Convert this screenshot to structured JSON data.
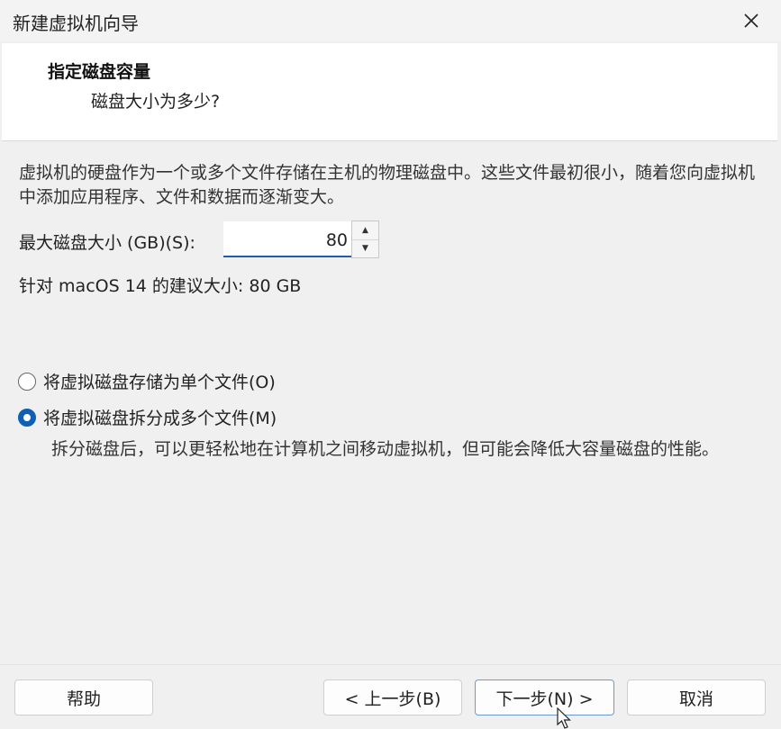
{
  "window": {
    "title": "新建虚拟机向导",
    "close_icon": "close-icon"
  },
  "header": {
    "title": "指定磁盘容量",
    "subtitle": "磁盘大小为多少?"
  },
  "description": "虚拟机的硬盘作为一个或多个文件存储在主机的物理磁盘中。这些文件最初很小，随着您向虚拟机中添加应用程序、文件和数据而逐渐变大。",
  "disk_size": {
    "label": "最大磁盘大小 (GB)(S):",
    "value": "80"
  },
  "recommendation": "针对 macOS 14 的建议大小: 80 GB",
  "options": [
    {
      "label": "将虚拟磁盘存储为单个文件(O)",
      "checked": false
    },
    {
      "label": "将虚拟磁盘拆分成多个文件(M)",
      "checked": true
    }
  ],
  "split_description": "拆分磁盘后，可以更轻松地在计算机之间移动虚拟机，但可能会降低大容量磁盘的性能。",
  "buttons": {
    "help": "帮助",
    "back": "< 上一步(B)",
    "next": "下一步(N) >",
    "cancel": "取消"
  },
  "colors": {
    "accent": "#0f5fb5"
  }
}
